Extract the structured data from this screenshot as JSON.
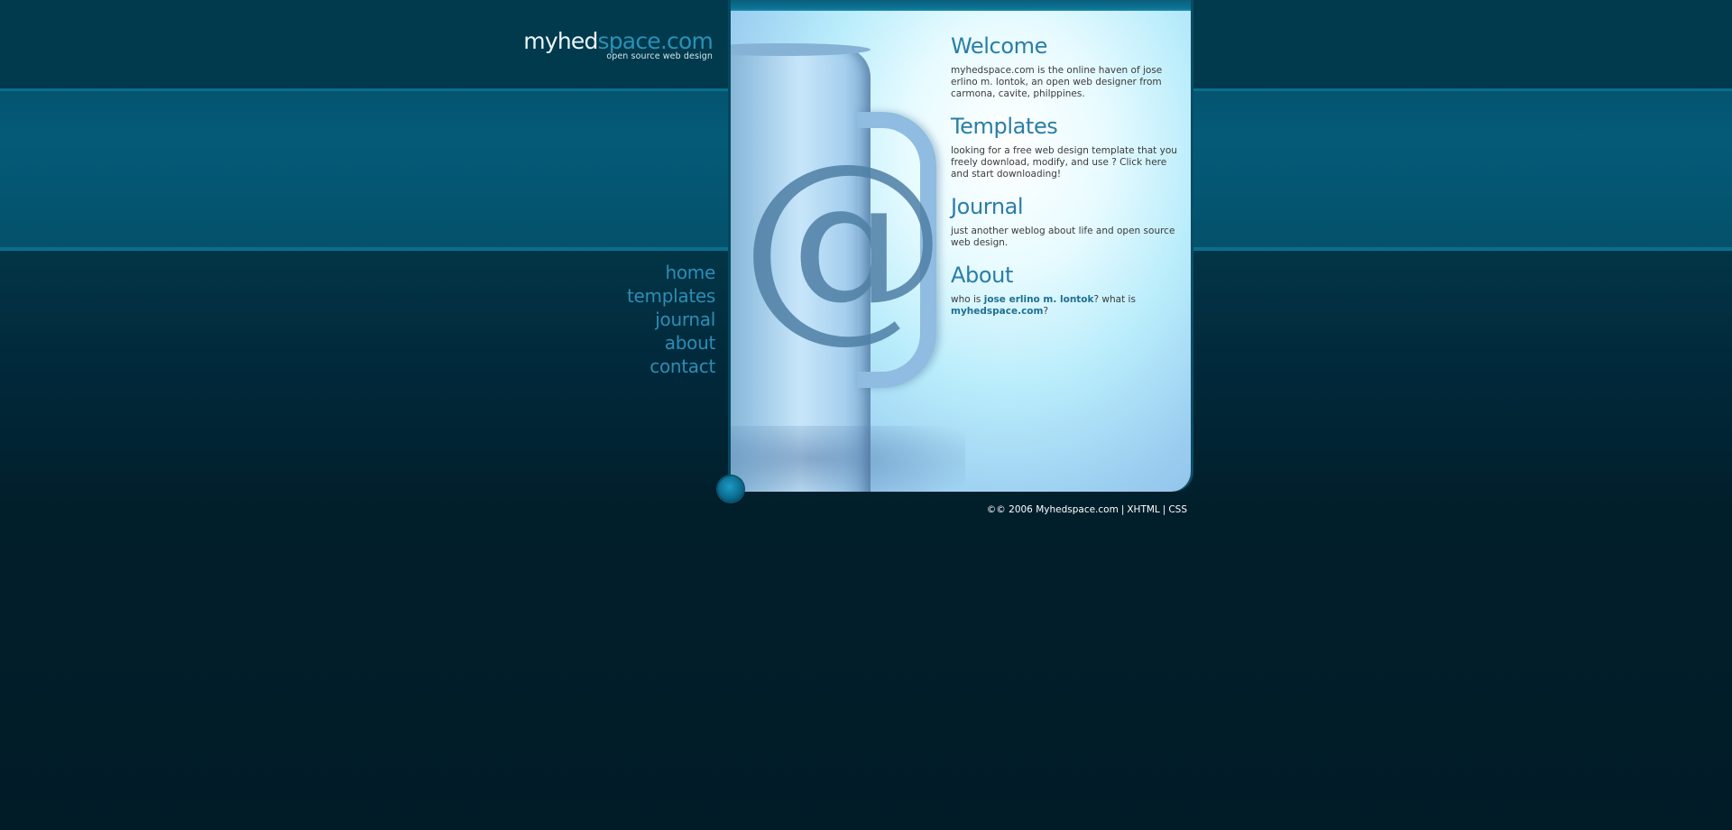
{
  "logo": {
    "part_a": "myhed",
    "part_b": "space",
    "part_c": ".com",
    "tagline": "open source web design"
  },
  "nav": {
    "items": [
      "home",
      "templates",
      "journal",
      "about",
      "contact"
    ]
  },
  "sections": {
    "welcome": {
      "heading": "Welcome",
      "text": "myhedspace.com is the online haven of jose erlino m. lontok, an open web designer from carmona, cavite, philppines."
    },
    "templates": {
      "heading": "Templates",
      "text": "looking for a free web design template that you freely download, modify, and use ? Click here and start downloading!"
    },
    "journal": {
      "heading": "Journal",
      "text": "just another weblog about life and open source web design."
    },
    "about": {
      "heading": "About",
      "text_1": "who is ",
      "link_1": "jose erlino m. lontok",
      "text_2": "? what is ",
      "link_2": "myhedspace.com",
      "text_3": "?"
    }
  },
  "photo": {
    "symbol": "@"
  },
  "footer": {
    "copyright": "©© 2006 Myhedspace.com",
    "sep": "|",
    "xhtml": "XHTML",
    "css": "CSS"
  },
  "colors": {
    "background_dark": "#011c27",
    "band_teal": "#04546e",
    "accent_blue": "#2d8db5",
    "heading_blue": "#2a7ea6"
  }
}
